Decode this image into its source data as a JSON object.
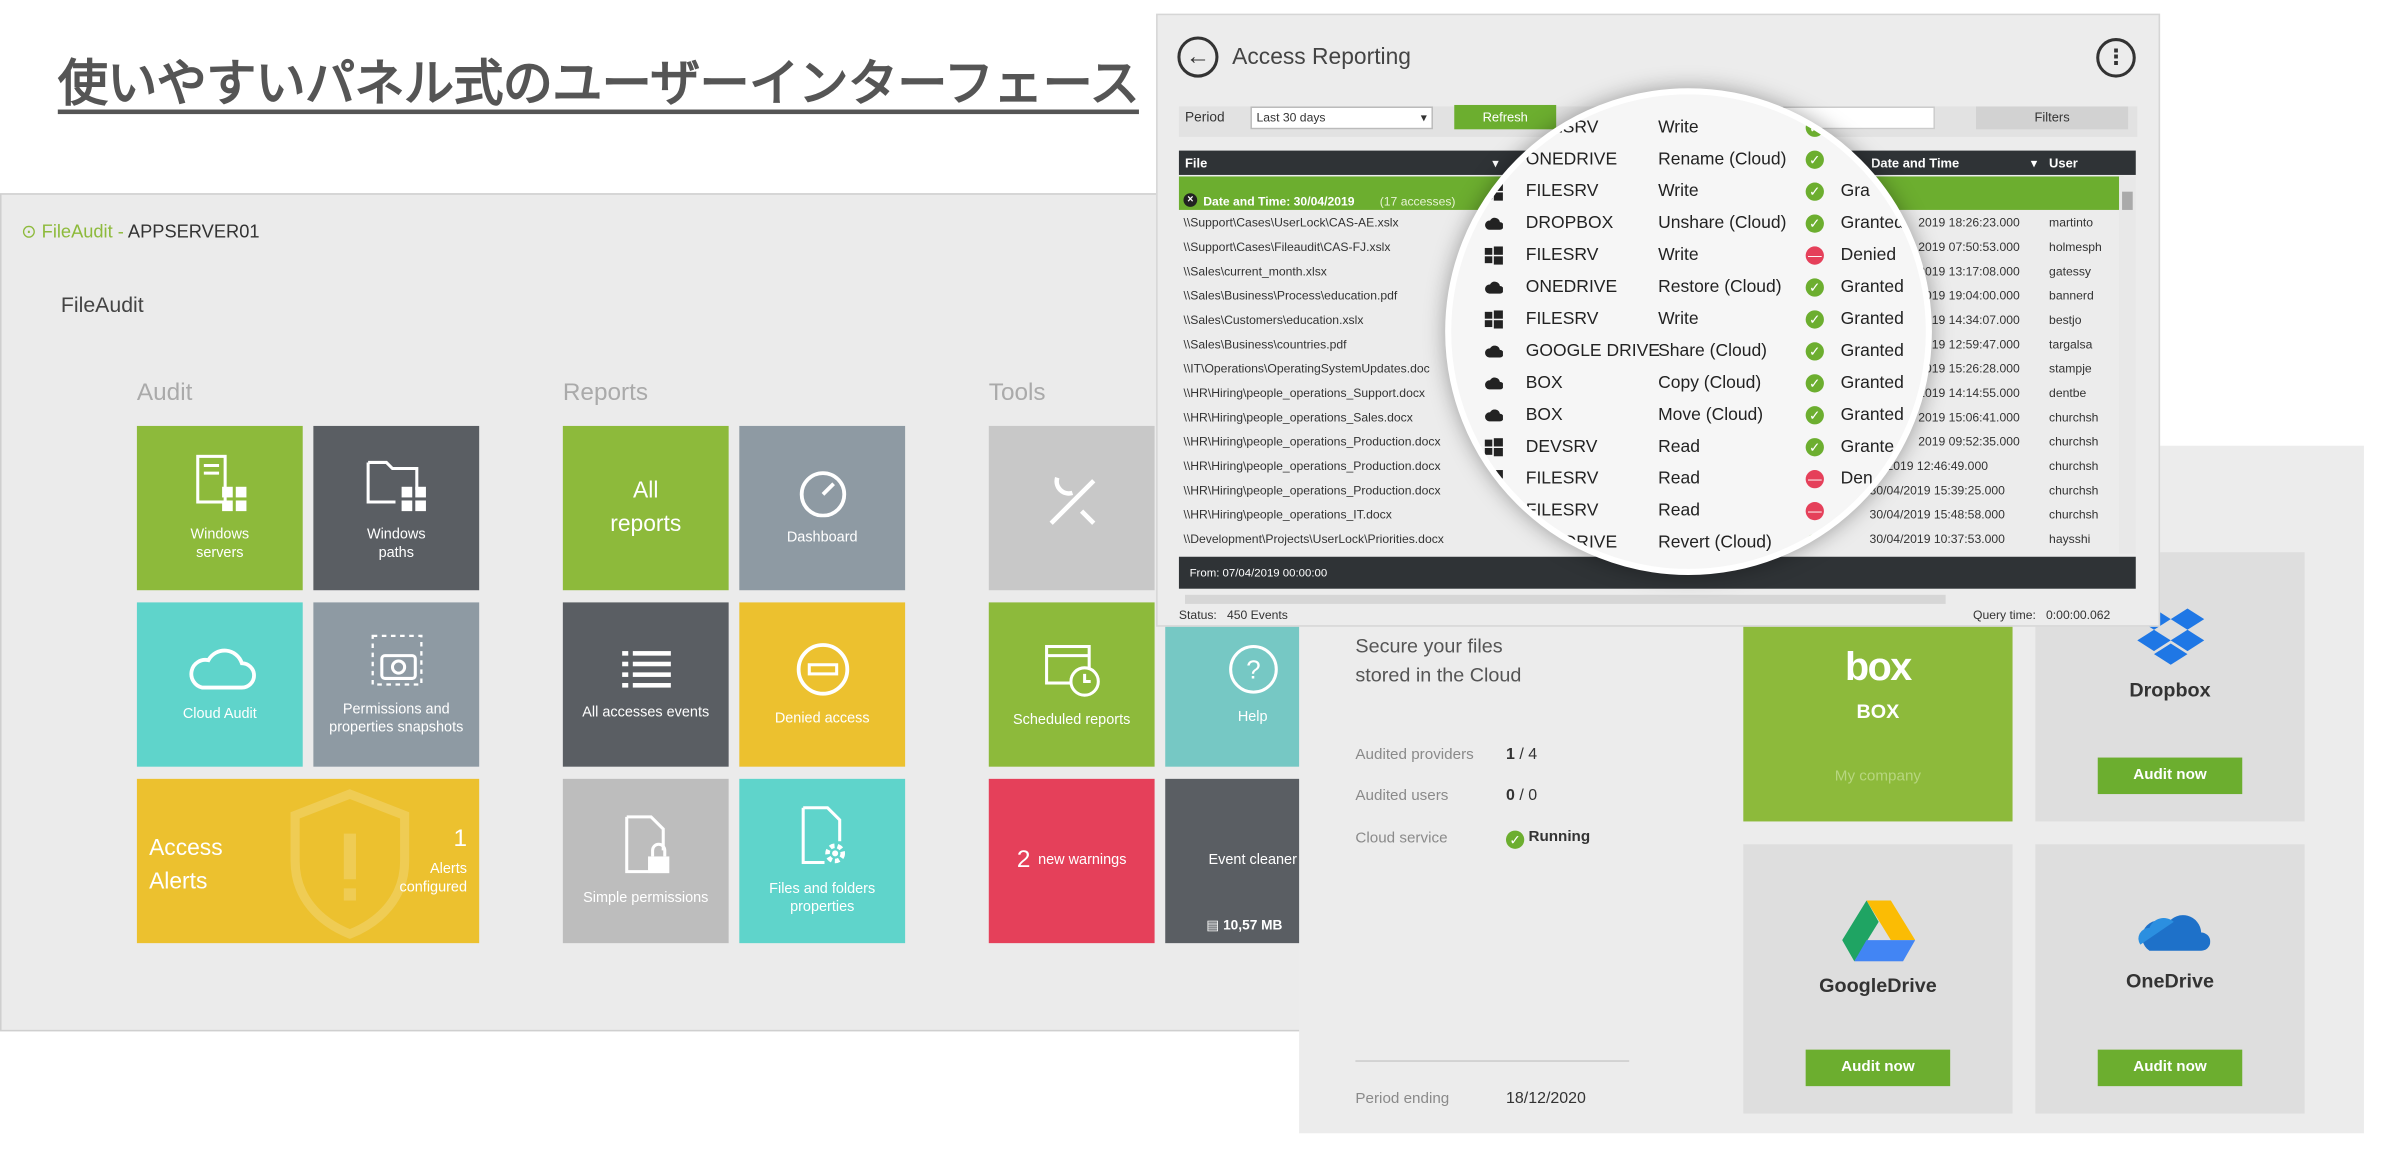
{
  "headline": "使いやすいパネル式のユーザーインターフェース",
  "fileaudit": {
    "brand": "FileAudit",
    "sep": " - ",
    "server": "APPSERVER01",
    "subtitle": "FileAudit",
    "sections": [
      "Audit",
      "Reports",
      "Tools"
    ],
    "tiles": {
      "windows_servers": "Windows servers",
      "windows_paths": "Windows paths",
      "cloud_audit": "Cloud Audit",
      "permissions_snapshots": "Permissions and properties snapshots",
      "access_alerts": "Access Alerts",
      "alerts_count": "1",
      "alerts_text": "Alerts configured",
      "all_reports": "All reports",
      "dashboard": "Dashboard",
      "all_accesses": "All accesses events",
      "denied_access": "Denied access",
      "simple_permissions": "Simple permissions",
      "files_folders": "Files and folders properties",
      "scheduled_reports": "Scheduled reports",
      "help": "Help",
      "warnings_count": "2",
      "warnings_text": "new warnings",
      "event_cleaner": "Event cleaner",
      "cleaner_size": "10,57 MB"
    }
  },
  "access_reporting": {
    "title": "Access Reporting",
    "period_label": "Period",
    "period_value": "Last 30 days",
    "refresh": "Refresh",
    "filters": "Filters",
    "columns": {
      "file": "File",
      "date": "Date and Time",
      "user": "User"
    },
    "group": {
      "label": "Date and Time: 30/04/2019",
      "count": "(17 accesses)"
    },
    "files": [
      "\\\\Support\\Cases\\UserLock\\CAS-AE.xslx",
      "\\\\Support\\Cases\\Fileaudit\\CAS-FJ.xslx",
      "\\\\Sales\\current_month.xlsx",
      "\\\\Sales\\Business\\Process\\education.pdf",
      "\\\\Sales\\Customers\\education.xslx",
      "\\\\Sales\\Business\\countries.pdf",
      "\\\\IT\\Operations\\OperatingSystemUpdates.doc",
      "\\\\HR\\Hiring\\people_operations_Support.docx",
      "\\\\HR\\Hiring\\people_operations_Sales.docx",
      "\\\\HR\\Hiring\\people_operations_Production.docx",
      "\\\\HR\\Hiring\\people_operations_Production.docx",
      "\\\\HR\\Hiring\\people_operations_Production.docx",
      "\\\\HR\\Hiring\\people_operations_IT.docx",
      "\\\\Development\\Projects\\UserLock\\Priorities.docx"
    ],
    "dates": [
      "2019 18:26:23.000",
      "2019 07:50:53.000",
      "2019 13:17:08.000",
      "2019 19:04:00.000",
      "2019 14:34:07.000",
      "2019 12:59:47.000",
      "2019 15:26:28.000",
      "2019 14:14:55.000",
      "2019 15:06:41.000",
      "2019 09:52:35.000",
      "04/2019 12:46:49.000",
      "30/04/2019 15:39:25.000",
      "30/04/2019 15:48:58.000",
      "30/04/2019 10:37:53.000"
    ],
    "users": [
      "martinto",
      "holmesph",
      "gatessy",
      "bannerd",
      "bestjo",
      "targalsa",
      "stampje",
      "dentbe",
      "churchsh",
      "churchsh",
      "churchsh",
      "churchsh",
      "churchsh",
      "haysshi"
    ],
    "status_from": "From: 07/04/2019 00:00:00",
    "status_label": "Status:",
    "events": "450 Events",
    "query_label": "Query time:",
    "query_value": "0:00:00.062"
  },
  "magnifier": {
    "rows": [
      {
        "icon": "windows",
        "server": "FILESRV",
        "action": "Write",
        "status": "",
        "ok": true
      },
      {
        "icon": "cloud",
        "server": "ONEDRIVE",
        "action": "Rename (Cloud)",
        "status": "",
        "ok": true
      },
      {
        "icon": "windows",
        "server": "FILESRV",
        "action": "Write",
        "status": "Gra",
        "ok": true
      },
      {
        "icon": "cloud",
        "server": "DROPBOX",
        "action": "Unshare (Cloud)",
        "status": "Granted",
        "ok": true
      },
      {
        "icon": "windows",
        "server": "FILESRV",
        "action": "Write",
        "status": "Denied",
        "ok": false
      },
      {
        "icon": "cloud",
        "server": "ONEDRIVE",
        "action": "Restore (Cloud)",
        "status": "Granted",
        "ok": true
      },
      {
        "icon": "windows",
        "server": "FILESRV",
        "action": "Write",
        "status": "Granted",
        "ok": true
      },
      {
        "icon": "cloud",
        "server": "GOOGLE DRIVE",
        "action": "Share (Cloud)",
        "status": "Granted",
        "ok": true
      },
      {
        "icon": "cloud",
        "server": "BOX",
        "action": "Copy (Cloud)",
        "status": "Granted",
        "ok": true
      },
      {
        "icon": "cloud",
        "server": "BOX",
        "action": "Move (Cloud)",
        "status": "Granted",
        "ok": true
      },
      {
        "icon": "windows",
        "server": "DEVSRV",
        "action": "Read",
        "status": "Grante",
        "ok": true
      },
      {
        "icon": "windows",
        "server": "FILESRV",
        "action": "Read",
        "status": "Den",
        "ok": false
      },
      {
        "icon": "windows",
        "server": "FILESRV",
        "action": "Read",
        "status": "",
        "ok": false
      },
      {
        "icon": "windows",
        "server": "ONEDRIVE",
        "action": "Revert (Cloud)",
        "status": "",
        "ok": true
      }
    ]
  },
  "cloud": {
    "secure": "Secure your files",
    "stored": "stored in the Cloud",
    "providers_label": "Audited providers",
    "providers_value": "1",
    "providers_total": " / 4",
    "users_label": "Audited users",
    "users_value": "0",
    "users_total": " / 0",
    "service_label": "Cloud service",
    "service_value": "Running",
    "period_label": "Period ending",
    "period_value": "18/12/2020",
    "box_logo": "box",
    "box": "BOX",
    "box_company": "My company",
    "dropbox": "Dropbox",
    "googledrive": "GoogleDrive",
    "onedrive": "OneDrive",
    "audit_now": "Audit now"
  },
  "colors": {
    "green": "#8dba3b",
    "dark": "#5a5e63",
    "teal": "#5fd4cb",
    "yellow": "#ecc12f",
    "red": "#e5405a"
  }
}
